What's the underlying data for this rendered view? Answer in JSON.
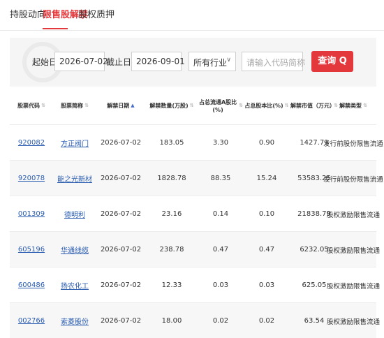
{
  "tabs": [
    {
      "label": "持股动向"
    },
    {
      "label": "限售股解禁"
    },
    {
      "label": "股权质押"
    }
  ],
  "filter": {
    "start_label": "起始日期：",
    "start_value": "2026-07-02",
    "end_label": "截止日期：",
    "end_value": "2026-09-01",
    "industry_value": "所有行业",
    "search_placeholder": "请输入代码简称",
    "query_label": "查询 Q"
  },
  "table": {
    "headers": [
      "股票代码",
      "股票简称",
      "解禁日期",
      "解禁数量(万股)",
      "占总流通A股比(%)",
      "占总股本比(%)",
      "解禁市值（万元）",
      "解禁类型"
    ],
    "rows": [
      {
        "code": "920082",
        "name": "方正阀门",
        "date": "2026-07-02",
        "qty": "183.05",
        "float_pct": "3.30",
        "total_pct": "0.90",
        "value": "1427.79",
        "type": "发行前股份限售流通"
      },
      {
        "code": "920078",
        "name": "能之光新材",
        "date": "2026-07-02",
        "qty": "1828.78",
        "float_pct": "88.35",
        "total_pct": "15.24",
        "value": "53583.25",
        "type": "发行前股份限售流通"
      },
      {
        "code": "001309",
        "name": "德明利",
        "date": "2026-07-02",
        "qty": "23.16",
        "float_pct": "0.14",
        "total_pct": "0.10",
        "value": "21838.79",
        "type": "股权激励限售流通"
      },
      {
        "code": "605196",
        "name": "华通线缆",
        "date": "2026-07-02",
        "qty": "238.78",
        "float_pct": "0.47",
        "total_pct": "0.47",
        "value": "6232.05",
        "type": "股权激励限售流通"
      },
      {
        "code": "600486",
        "name": "扬农化工",
        "date": "2026-07-02",
        "qty": "12.33",
        "float_pct": "0.03",
        "total_pct": "0.03",
        "value": "625.05",
        "type": "股权激励限售流通"
      },
      {
        "code": "002766",
        "name": "索菱股份",
        "date": "2026-07-02",
        "qty": "18.00",
        "float_pct": "0.02",
        "total_pct": "0.02",
        "value": "63.54",
        "type": "股权激励限售流通"
      }
    ]
  },
  "colors": {
    "accent": "#e4393c",
    "link": "#2a5db0",
    "sort_active": "#4a6fc8"
  },
  "icons": {
    "sort": "sort-arrows-icon",
    "sort_active": "sort-up-icon",
    "dropdown": "caret-down-icon",
    "search": "search-icon"
  }
}
